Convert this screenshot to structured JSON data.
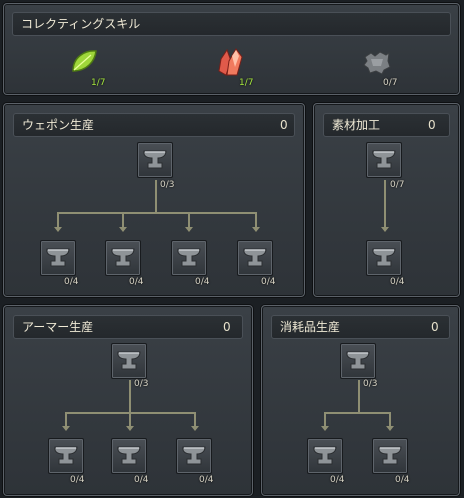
{
  "collecting": {
    "title": "コレクティングスキル",
    "items": [
      {
        "icon": "herb-leaf-icon",
        "level": "1/7"
      },
      {
        "icon": "crystal-ore-icon",
        "level": "1/7"
      },
      {
        "icon": "hide-pelt-icon",
        "level": "0/7"
      }
    ]
  },
  "weapon": {
    "title": "ウェポン生産",
    "count": "0",
    "root": "0/3",
    "children": [
      "0/4",
      "0/4",
      "0/4",
      "0/4"
    ]
  },
  "material": {
    "title": "素材加工",
    "count": "0",
    "root": "0/7",
    "child": "0/4"
  },
  "armor": {
    "title": "アーマー生産",
    "count": "0",
    "root": "0/3",
    "children": [
      "0/4",
      "0/4",
      "0/4"
    ]
  },
  "consumable": {
    "title": "消耗品生産",
    "count": "0",
    "root": "0/3",
    "children": [
      "0/4",
      "0/4"
    ]
  },
  "colors": {
    "level_active": "#a6e83e",
    "level_inactive": "#d7d3c4",
    "connector": "#8f8f73"
  }
}
